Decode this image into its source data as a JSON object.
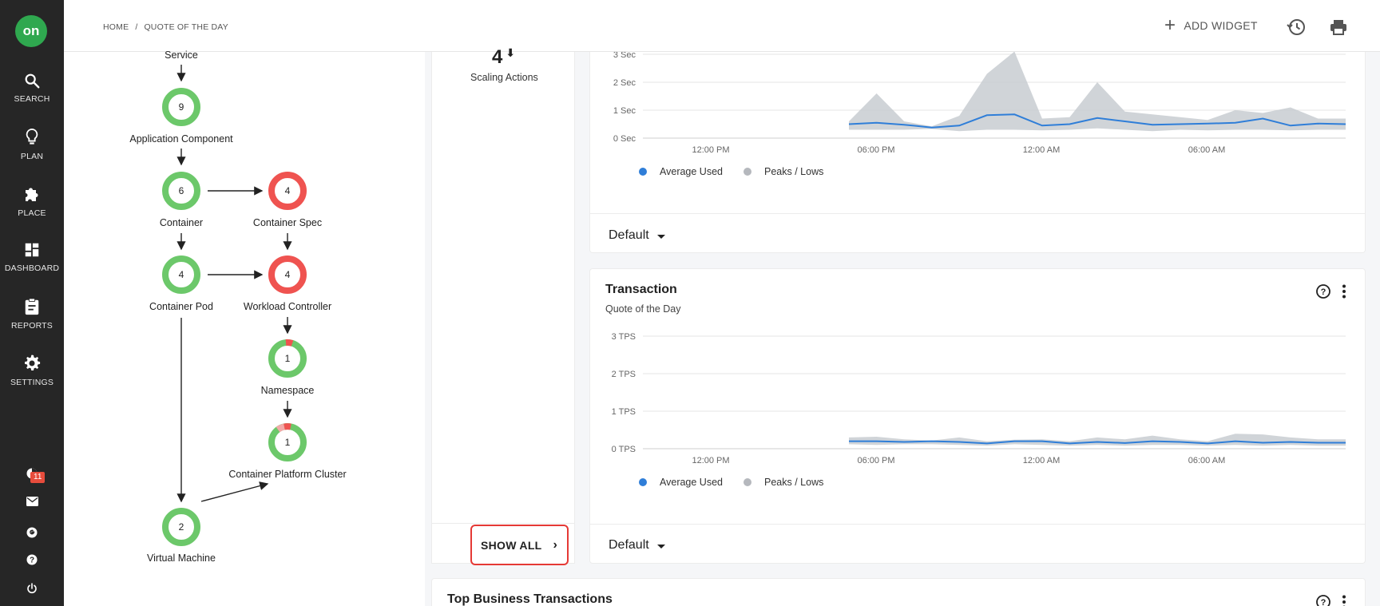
{
  "app": {
    "logo_text": "on",
    "accent": "#2fa84f"
  },
  "sidebar": {
    "items": [
      {
        "label": "SEARCH",
        "icon": "search-icon"
      },
      {
        "label": "PLAN",
        "icon": "lightbulb-icon"
      },
      {
        "label": "PLACE",
        "icon": "puzzle-icon"
      },
      {
        "label": "DASHBOARD",
        "icon": "dashboard-icon"
      },
      {
        "label": "REPORTS",
        "icon": "clipboard-icon"
      },
      {
        "label": "SETTINGS",
        "icon": "gear-icon"
      }
    ],
    "notification_count": "11",
    "bottom_icons": [
      "notification-icon",
      "mail-icon",
      "google-icon",
      "help-icon",
      "power-icon"
    ]
  },
  "header": {
    "breadcrumb": [
      "HOME",
      "QUOTE OF THE DAY"
    ],
    "breadcrumb_sep": "/",
    "add_widget": "ADD WIDGET",
    "add_icon": "plus-icon",
    "history_icon": "history-icon",
    "print_icon": "print-icon"
  },
  "topology": {
    "nodes": [
      {
        "id": "service",
        "label": "Service",
        "value": null,
        "status": "none"
      },
      {
        "id": "app_component",
        "label": "Application Component",
        "value": "9",
        "status": "green"
      },
      {
        "id": "container",
        "label": "Container",
        "value": "6",
        "status": "green"
      },
      {
        "id": "container_spec",
        "label": "Container Spec",
        "value": "4",
        "status": "red"
      },
      {
        "id": "container_pod",
        "label": "Container Pod",
        "value": "4",
        "status": "green"
      },
      {
        "id": "workload_controller",
        "label": "Workload Controller",
        "value": "4",
        "status": "red"
      },
      {
        "id": "namespace",
        "label": "Namespace",
        "value": "1",
        "status": "green-mixed"
      },
      {
        "id": "container_platform_cluster",
        "label": "Container Platform Cluster",
        "value": "1",
        "status": "green-mixed"
      },
      {
        "id": "virtual_machine",
        "label": "Virtual Machine",
        "value": "2",
        "status": "green"
      }
    ],
    "colors": {
      "green": "#6cc86a",
      "red": "#ef5350",
      "pink": "#f3a9a8"
    }
  },
  "actions": {
    "count": "4",
    "arrow": "⬇",
    "label": "Scaling Actions",
    "show_all": "SHOW ALL"
  },
  "response_card": {
    "dropdown": "Default"
  },
  "transaction_card": {
    "title": "Transaction",
    "subtitle": "Quote of the Day",
    "dropdown": "Default"
  },
  "top_business": {
    "title": "Top Business Transactions"
  },
  "chart_data": [
    {
      "type": "area",
      "title": "",
      "xlabel": "",
      "ylabel": "",
      "x": [
        "12:00 PM",
        "06:00 PM",
        "12:00 AM",
        "06:00 AM"
      ],
      "y_ticks": [
        "0 Sec",
        "1 Sec",
        "2 Sec",
        "3 Sec"
      ],
      "ylim": [
        0,
        3
      ],
      "grid": true,
      "legend_position": "bottom-left",
      "legend": [
        "Average Used",
        "Peaks / Lows"
      ],
      "series": [
        {
          "name": "Average Used",
          "color": "#2f7ed8",
          "values": [
            0.5,
            0.55,
            0.48,
            0.38,
            0.45,
            0.82,
            0.85,
            0.45,
            0.5,
            0.72,
            0.6,
            0.48,
            0.5,
            0.52,
            0.55,
            0.7,
            0.45,
            0.52,
            0.5
          ]
        },
        {
          "name": "Peaks / Lows",
          "color": "#c8ccd1",
          "highs": [
            0.6,
            1.6,
            0.6,
            0.42,
            0.8,
            2.3,
            3.1,
            0.7,
            0.75,
            2.0,
            0.95,
            0.85,
            0.75,
            0.65,
            1.0,
            0.9,
            1.1,
            0.7,
            0.7
          ],
          "lows": [
            0.3,
            0.3,
            0.3,
            0.33,
            0.25,
            0.3,
            0.3,
            0.28,
            0.3,
            0.35,
            0.3,
            0.25,
            0.3,
            0.28,
            0.3,
            0.3,
            0.28,
            0.3,
            0.3
          ]
        }
      ]
    },
    {
      "type": "area",
      "title": "Transaction",
      "xlabel": "",
      "ylabel": "",
      "x": [
        "12:00 PM",
        "06:00 PM",
        "12:00 AM",
        "06:00 AM"
      ],
      "y_ticks": [
        "0 TPS",
        "1 TPS",
        "2 TPS",
        "3 TPS"
      ],
      "ylim": [
        0,
        3
      ],
      "grid": true,
      "legend_position": "bottom-left",
      "legend": [
        "Average Used",
        "Peaks / Lows"
      ],
      "series": [
        {
          "name": "Average Used",
          "color": "#2f7ed8",
          "values": [
            0.2,
            0.2,
            0.18,
            0.2,
            0.18,
            0.14,
            0.2,
            0.2,
            0.14,
            0.18,
            0.15,
            0.2,
            0.18,
            0.14,
            0.2,
            0.16,
            0.18,
            0.16,
            0.16
          ]
        },
        {
          "name": "Peaks / Lows",
          "color": "#c8ccd1",
          "highs": [
            0.3,
            0.32,
            0.25,
            0.22,
            0.3,
            0.2,
            0.24,
            0.25,
            0.2,
            0.3,
            0.25,
            0.35,
            0.25,
            0.2,
            0.4,
            0.38,
            0.3,
            0.25,
            0.25
          ],
          "lows": [
            0.12,
            0.1,
            0.12,
            0.12,
            0.1,
            0.08,
            0.12,
            0.1,
            0.08,
            0.1,
            0.08,
            0.1,
            0.1,
            0.08,
            0.1,
            0.08,
            0.1,
            0.08,
            0.08
          ]
        }
      ]
    }
  ]
}
